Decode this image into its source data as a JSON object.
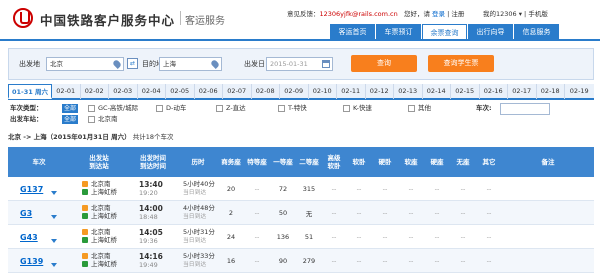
{
  "header": {
    "site_title": "中国铁路客户服务中心",
    "site_sub": "客运服务",
    "feedback_label": "意见反馈：",
    "feedback_email": "12306yjfk@rails.com.cn",
    "greeting": "您好，请",
    "login": "登录",
    "register": "注册",
    "my12306": "我的12306",
    "mobile": "手机版"
  },
  "nav": [
    {
      "label": "客运首页"
    },
    {
      "label": "车票预订"
    },
    {
      "label": "余票查询"
    },
    {
      "label": "出行向导"
    },
    {
      "label": "信息服务"
    }
  ],
  "search": {
    "from_label": "出发地",
    "from_value": "北京",
    "to_label": "目的地",
    "to_value": "上海",
    "date_label": "出发日",
    "date_value": "2015-01-31",
    "query_button": "查询",
    "student_button": "查询学生票"
  },
  "dates": [
    "01-31 周六",
    "02-01",
    "02-02",
    "02-03",
    "02-04",
    "02-05",
    "02-06",
    "02-07",
    "02-08",
    "02-09",
    "02-10",
    "02-11",
    "02-12",
    "02-13",
    "02-14",
    "02-15",
    "02-16",
    "02-17",
    "02-18",
    "02-19"
  ],
  "filters": {
    "type_label": "车次类型：",
    "all": "全部",
    "types": [
      "GC-高铁/城际",
      "D-动车",
      "Z-直达",
      "T-特快",
      "K-快速",
      "其他"
    ],
    "station_label": "出发车站：",
    "station_all": "全部",
    "stations": [
      "北京南"
    ],
    "arrive_label": "车次:"
  },
  "summary": {
    "route": "北京 -> 上海（2015年01月31日  周六）",
    "count": "共计18个车次"
  },
  "table": {
    "headers": [
      "车次",
      "出发站\n到达站",
      "出发时间\n到达时间",
      "历时",
      "商务座",
      "特等座",
      "一等座",
      "二等座",
      "高级\n软卧",
      "软卧",
      "硬卧",
      "软座",
      "硬座",
      "无座",
      "其它",
      "备注"
    ],
    "rows": [
      {
        "train": "G137",
        "from": "北京南",
        "to": "上海虹桥",
        "dep": "13:40",
        "arr": "19:20",
        "dur": "5小时40分",
        "day": "当日到达",
        "seats": [
          "20",
          "--",
          "72",
          "315",
          "--",
          "--",
          "--",
          "--",
          "--",
          "--",
          "--"
        ]
      },
      {
        "train": "G3",
        "from": "北京南",
        "to": "上海虹桥",
        "dep": "14:00",
        "arr": "18:48",
        "dur": "4小时48分",
        "day": "当日到达",
        "seats": [
          "2",
          "--",
          "50",
          "无",
          "--",
          "--",
          "--",
          "--",
          "--",
          "--",
          "--"
        ]
      },
      {
        "train": "G43",
        "from": "北京南",
        "to": "上海虹桥",
        "dep": "14:05",
        "arr": "19:36",
        "dur": "5小时31分",
        "day": "当日到达",
        "seats": [
          "24",
          "--",
          "136",
          "51",
          "--",
          "--",
          "--",
          "--",
          "--",
          "--",
          "--"
        ]
      },
      {
        "train": "G139",
        "from": "北京南",
        "to": "上海虹桥",
        "dep": "14:16",
        "arr": "19:49",
        "dur": "5小时33分",
        "day": "当日到达",
        "seats": [
          "16",
          "--",
          "90",
          "279",
          "--",
          "--",
          "--",
          "--",
          "--",
          "--",
          "--"
        ]
      }
    ]
  }
}
